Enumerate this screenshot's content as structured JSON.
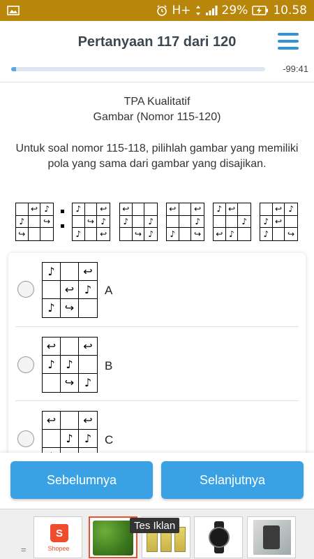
{
  "status_bar": {
    "network": "H+",
    "battery": "29%",
    "time": "10.58",
    "icons": [
      "image-icon",
      "alarm-icon",
      "signal-icon",
      "battery-charging-icon"
    ]
  },
  "header": {
    "title": "Pertanyaan 117 dari 120",
    "timer": "-99:41",
    "progress_fraction": 0.02,
    "menu_icon": "hamburger-menu-icon"
  },
  "question": {
    "section_line1": "TPA Kualitatif",
    "section_line2": "Gambar (Nomor 115-120)",
    "text": "Untuk soal nomor 115-118, pilihlah gambar yang memiliki pola yang sama dari gambar yang disajikan."
  },
  "figures": {
    "sequence": [
      [
        "",
        "↩",
        "♪",
        "♪",
        "",
        "↪",
        "↪",
        "",
        ""
      ],
      [
        "♪",
        "",
        "↩",
        "",
        "↪",
        "♪",
        "♪",
        "",
        "↩"
      ],
      [
        "↩",
        "",
        "",
        "♪",
        "",
        "♪",
        "",
        "↪",
        "♪"
      ],
      [
        "↩",
        "",
        "↩",
        "",
        "",
        "♪",
        "♪",
        "",
        "↪"
      ],
      [
        "♪",
        "↩",
        "",
        "",
        "",
        "♪",
        "↩",
        "♪",
        ""
      ],
      [
        "",
        "↩",
        "♪",
        "♪",
        "↩",
        "",
        "♪",
        "",
        "↪"
      ]
    ]
  },
  "options": [
    {
      "label": "A",
      "cells": [
        "♪",
        "",
        "↩",
        "",
        "↩",
        "♪",
        "♪",
        "↪",
        ""
      ]
    },
    {
      "label": "B",
      "cells": [
        "↩",
        "",
        "↩",
        "♪",
        "♪",
        "",
        "",
        "↪",
        "♪"
      ]
    },
    {
      "label": "C",
      "cells": [
        "↩",
        "",
        "↩",
        "",
        "♪",
        "♪",
        "♪",
        "",
        ""
      ]
    }
  ],
  "buttons": {
    "prev": "Sebelumnya",
    "next": "Selanjutnya"
  },
  "ads": {
    "tooltip": "Tes Iklan",
    "shopee_label": "Shopee",
    "eq_symbol": "="
  },
  "colors": {
    "accent": "#3aa2e4",
    "status_bar": "#b8860b",
    "title": "#3a4750",
    "shopee": "#ee4d2d"
  }
}
